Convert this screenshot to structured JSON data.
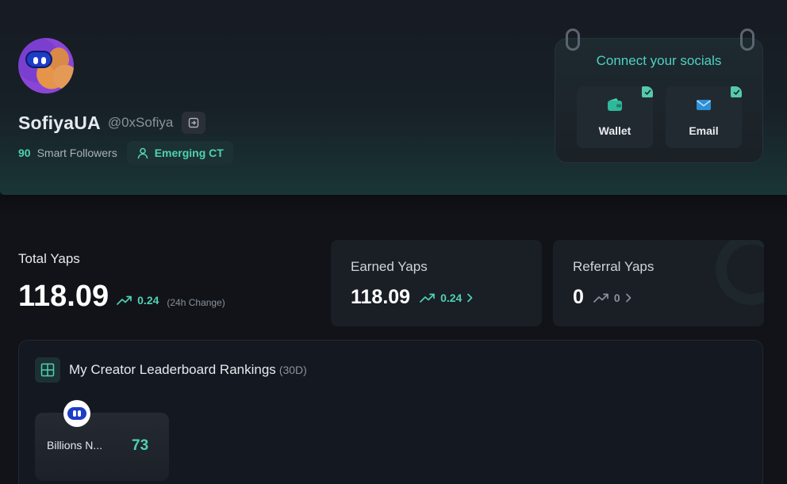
{
  "profile": {
    "display_name": "SofiyaUA",
    "handle": "@0xSofiya",
    "smart_followers_count": "90",
    "smart_followers_label": "Smart Followers",
    "badge_label": "Emerging CT"
  },
  "socials": {
    "title": "Connect your socials",
    "items": [
      {
        "label": "Wallet",
        "icon": "wallet-icon",
        "connected": true
      },
      {
        "label": "Email",
        "icon": "mail-icon",
        "connected": true
      }
    ]
  },
  "stats": {
    "total": {
      "label": "Total Yaps",
      "value": "118.09",
      "change": "0.24",
      "change_note": "(24h Change)"
    },
    "earned": {
      "label": "Earned Yaps",
      "value": "118.09",
      "change": "0.24"
    },
    "referral": {
      "label": "Referral Yaps",
      "value": "0",
      "change": "0"
    }
  },
  "rankings": {
    "title": "My Creator Leaderboard Rankings",
    "period": "(30D)",
    "items": [
      {
        "name": "Billions N...",
        "score": "73"
      }
    ]
  },
  "colors": {
    "accent": "#4fd1b4",
    "background": "#111318",
    "card": "#1a1e25"
  }
}
